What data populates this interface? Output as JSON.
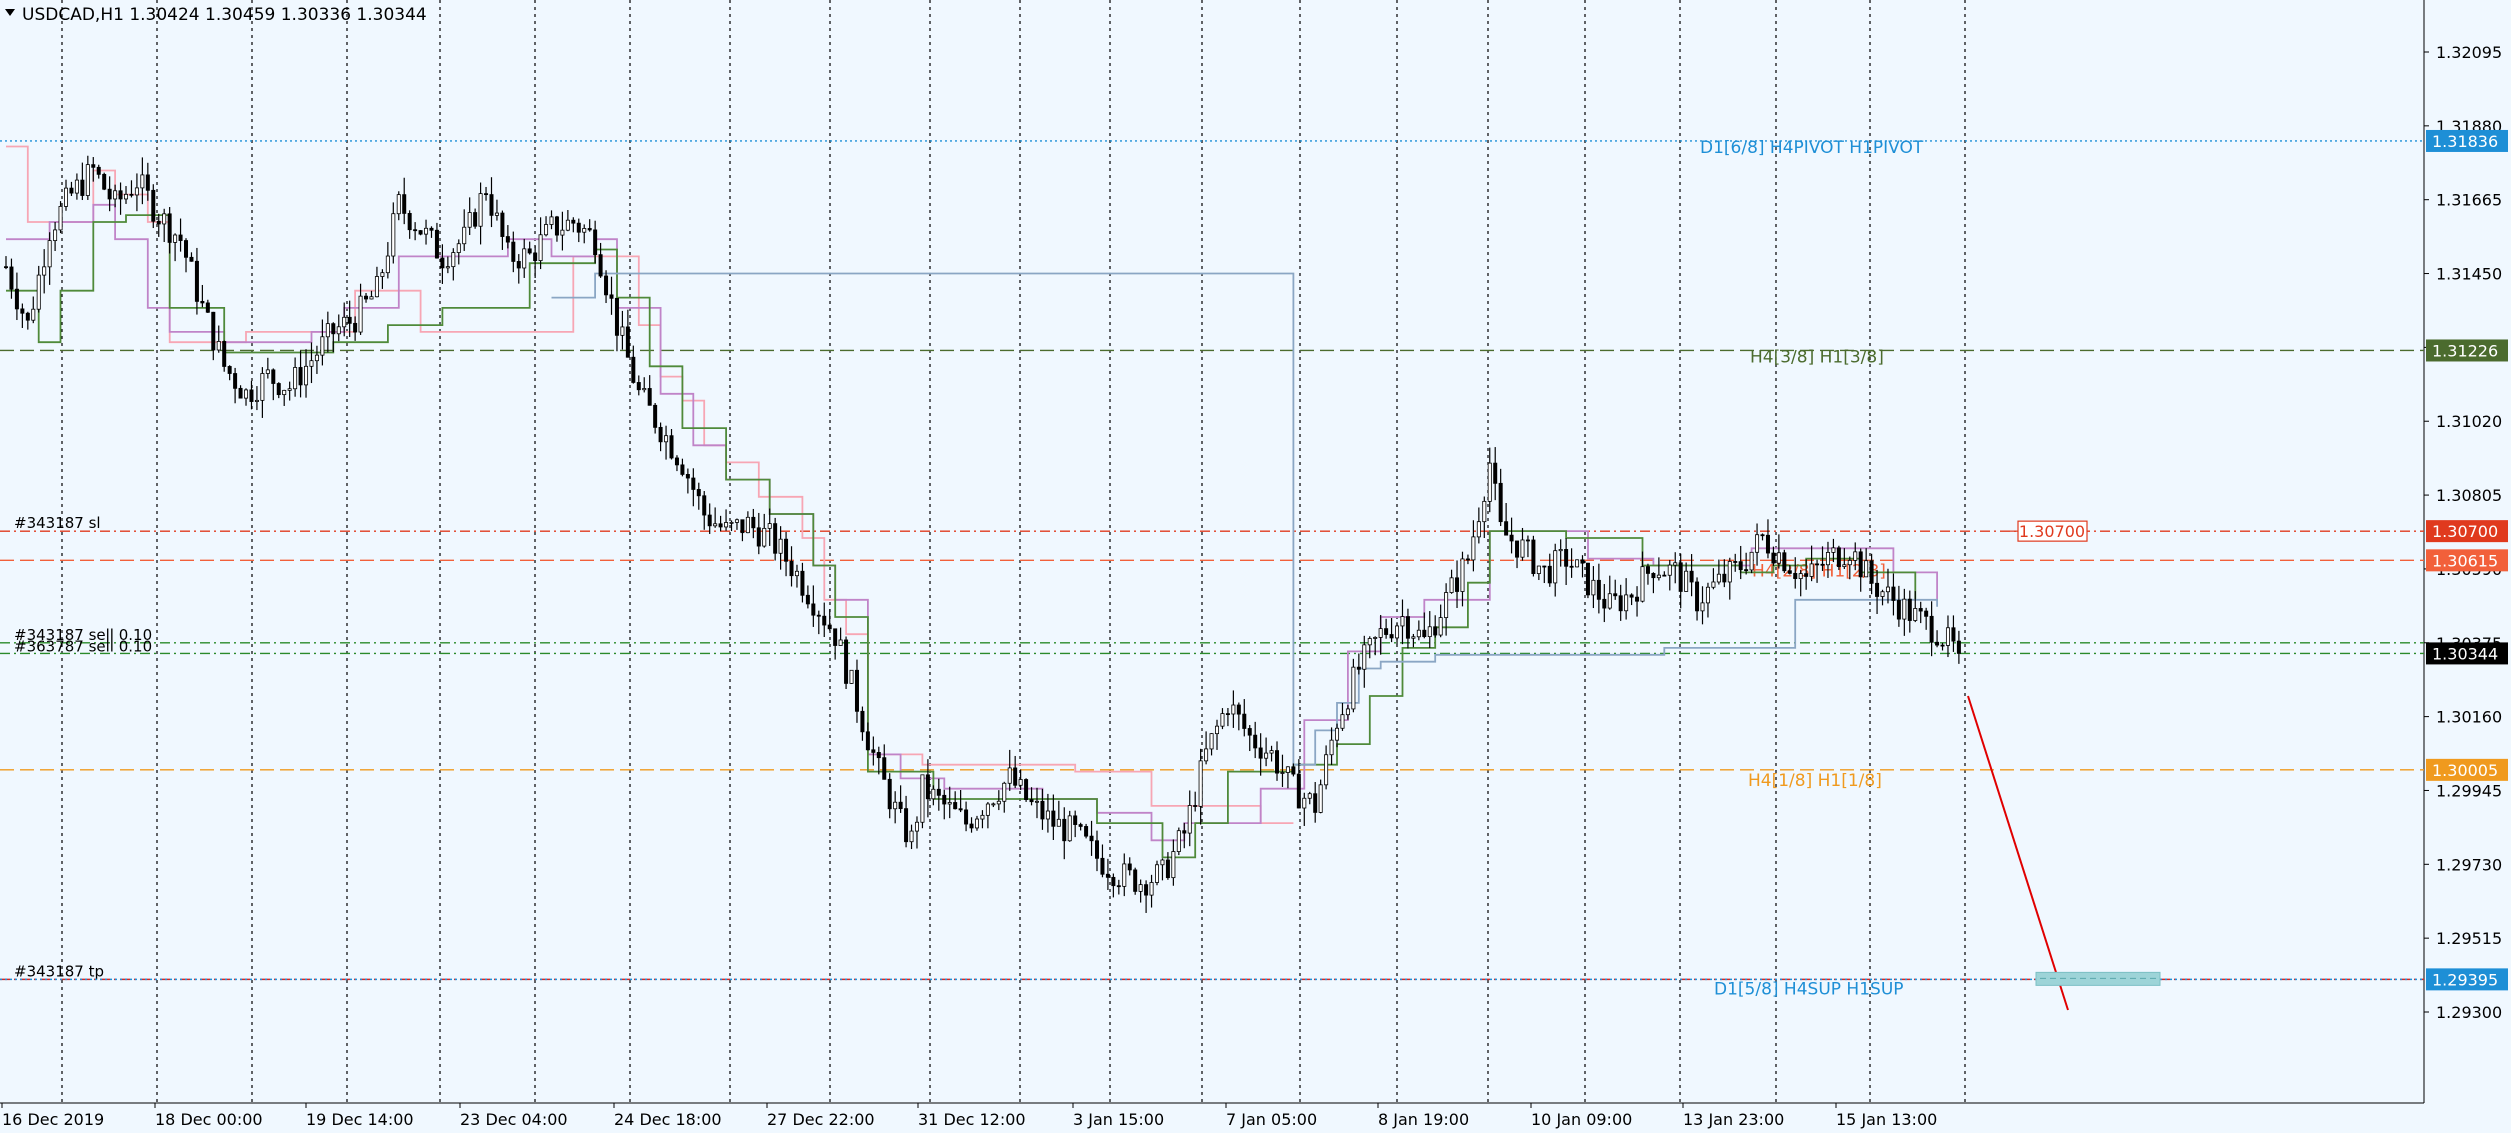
{
  "window": {
    "symbol_title": "USDCAD,H1  1.30424 1.30459 1.30336 1.30344"
  },
  "colors": {
    "background": "#f0f8ff",
    "grid": "#000000",
    "candle_up": "#3a3a3a",
    "candle_down": "#111111",
    "line_pink": "#f7a6b4",
    "line_violet": "#c084c8",
    "line_green": "#4f8a3a",
    "line_blue": "#8aa6c4",
    "trend_arrow": "#e00000",
    "target_box": "#9dd4d8"
  },
  "chart_data": {
    "type": "candlestick",
    "symbol": "USDCAD",
    "timeframe": "H1",
    "ohlc_header": {
      "open": 1.30424,
      "high": 1.30459,
      "low": 1.30336,
      "close": 1.30344
    },
    "ylim": [
      1.292,
      1.322
    ],
    "y_ticks": [
      "1.32095",
      "1.31880",
      "1.31665",
      "1.31450",
      "1.31235",
      "1.31020",
      "1.30805",
      "1.30590",
      "1.30375",
      "1.30160",
      "1.29945",
      "1.29730",
      "1.29515",
      "1.29300"
    ],
    "x_ticks": [
      "16 Dec 2019",
      "18 Dec 00:00",
      "19 Dec 14:00",
      "23 Dec 04:00",
      "24 Dec 18:00",
      "27 Dec 22:00",
      "31 Dec 12:00",
      "3 Jan 15:00",
      "7 Jan 05:00",
      "8 Jan 19:00",
      "10 Jan 09:00",
      "13 Jan 23:00",
      "15 Jan 13:00"
    ],
    "grid": true,
    "bars": 218,
    "price_path": [
      [
        0,
        1.3147
      ],
      [
        4,
        1.313
      ],
      [
        8,
        1.3158
      ],
      [
        12,
        1.3168
      ],
      [
        16,
        1.3175
      ],
      [
        20,
        1.3165
      ],
      [
        24,
        1.3172
      ],
      [
        28,
        1.3162
      ],
      [
        32,
        1.3155
      ],
      [
        36,
        1.3135
      ],
      [
        40,
        1.3118
      ],
      [
        44,
        1.311
      ],
      [
        48,
        1.3115
      ],
      [
        52,
        1.3112
      ],
      [
        56,
        1.312
      ],
      [
        60,
        1.3128
      ],
      [
        64,
        1.3132
      ],
      [
        68,
        1.314
      ],
      [
        72,
        1.3165
      ],
      [
        76,
        1.3158
      ],
      [
        80,
        1.315
      ],
      [
        84,
        1.3155
      ],
      [
        88,
        1.317
      ],
      [
        92,
        1.315
      ],
      [
        96,
        1.315
      ],
      [
        100,
        1.3158
      ],
      [
        104,
        1.316
      ],
      [
        108,
        1.3155
      ],
      [
        112,
        1.313
      ],
      [
        116,
        1.311
      ],
      [
        120,
        1.31
      ],
      [
        124,
        1.309
      ],
      [
        128,
        1.3075
      ],
      [
        132,
        1.307
      ],
      [
        136,
        1.3072
      ],
      [
        140,
        1.3068
      ],
      [
        144,
        1.306
      ],
      [
        148,
        1.305
      ],
      [
        152,
        1.304
      ],
      [
        156,
        1.302
      ],
      [
        160,
        1.3
      ],
      [
        164,
        1.2985
      ],
      [
        166,
        1.298
      ],
      [
        168,
        1.2995
      ],
      [
        172,
        1.299
      ],
      [
        176,
        1.2985
      ],
      [
        180,
        1.2992
      ],
      [
        184,
        1.2998
      ],
      [
        188,
        1.299
      ],
      [
        192,
        1.2985
      ],
      [
        196,
        1.2982
      ],
      [
        200,
        1.2975
      ],
      [
        204,
        1.297
      ],
      [
        208,
        1.2968
      ],
      [
        212,
        1.297
      ],
      [
        216,
        1.2982
      ],
      [
        220,
        1.3005
      ],
      [
        224,
        1.302
      ],
      [
        228,
        1.301
      ],
      [
        232,
        1.3005
      ],
      [
        236,
        1.2995
      ],
      [
        240,
        1.299
      ],
      [
        244,
        1.3015
      ],
      [
        248,
        1.303
      ],
      [
        252,
        1.304
      ],
      [
        256,
        1.3045
      ],
      [
        260,
        1.3038
      ],
      [
        264,
        1.305
      ],
      [
        268,
        1.3062
      ],
      [
        272,
        1.309
      ],
      [
        274,
        1.307
      ],
      [
        278,
        1.3065
      ],
      [
        282,
        1.3058
      ],
      [
        286,
        1.3062
      ],
      [
        290,
        1.3055
      ],
      [
        294,
        1.3048
      ],
      [
        298,
        1.3052
      ],
      [
        302,
        1.306
      ],
      [
        306,
        1.3058
      ],
      [
        310,
        1.305
      ],
      [
        314,
        1.3055
      ],
      [
        318,
        1.306
      ],
      [
        322,
        1.3068
      ],
      [
        326,
        1.3062
      ],
      [
        330,
        1.3056
      ],
      [
        334,
        1.3062
      ],
      [
        338,
        1.3065
      ],
      [
        342,
        1.3055
      ],
      [
        346,
        1.305
      ],
      [
        350,
        1.3045
      ],
      [
        354,
        1.3041
      ],
      [
        358,
        1.3034
      ]
    ],
    "ma_lines": [
      {
        "color_key": "line_pink",
        "points": [
          [
            0,
            1.3182
          ],
          [
            4,
            1.316
          ],
          [
            10,
            1.316
          ],
          [
            16,
            1.3175
          ],
          [
            20,
            1.3168
          ],
          [
            26,
            1.316
          ],
          [
            30,
            1.3125
          ],
          [
            40,
            1.3125
          ],
          [
            44,
            1.3128
          ],
          [
            60,
            1.3128
          ],
          [
            64,
            1.314
          ],
          [
            72,
            1.314
          ],
          [
            76,
            1.3128
          ],
          [
            100,
            1.3128
          ],
          [
            104,
            1.315
          ],
          [
            112,
            1.315
          ],
          [
            116,
            1.313
          ],
          [
            120,
            1.3115
          ],
          [
            124,
            1.3108
          ],
          [
            128,
            1.3095
          ],
          [
            132,
            1.309
          ],
          [
            138,
            1.308
          ],
          [
            146,
            1.3068
          ],
          [
            150,
            1.305
          ],
          [
            154,
            1.304
          ],
          [
            158,
            1.3005
          ],
          [
            166,
            1.3005
          ],
          [
            168,
            1.3002
          ],
          [
            190,
            1.3002
          ],
          [
            196,
            1.3
          ],
          [
            210,
            1.299
          ],
          [
            216,
            1.299
          ],
          [
            230,
            1.2985
          ],
          [
            236,
            1.2985
          ]
        ]
      },
      {
        "color_key": "line_violet",
        "points": [
          [
            0,
            1.3155
          ],
          [
            8,
            1.316
          ],
          [
            16,
            1.3165
          ],
          [
            20,
            1.3155
          ],
          [
            26,
            1.3135
          ],
          [
            30,
            1.3128
          ],
          [
            40,
            1.3125
          ],
          [
            56,
            1.3128
          ],
          [
            62,
            1.3135
          ],
          [
            72,
            1.315
          ],
          [
            80,
            1.315
          ],
          [
            92,
            1.3155
          ],
          [
            100,
            1.315
          ],
          [
            108,
            1.3155
          ],
          [
            112,
            1.3135
          ],
          [
            120,
            1.311
          ],
          [
            126,
            1.3095
          ],
          [
            132,
            1.3085
          ],
          [
            140,
            1.3075
          ],
          [
            148,
            1.306
          ],
          [
            152,
            1.305
          ],
          [
            158,
            1.3005
          ],
          [
            164,
            1.2998
          ],
          [
            172,
            1.2995
          ],
          [
            190,
            1.2992
          ],
          [
            200,
            1.2988
          ],
          [
            210,
            1.298
          ],
          [
            216,
            1.2985
          ],
          [
            230,
            1.2995
          ],
          [
            238,
            1.3015
          ],
          [
            246,
            1.3035
          ],
          [
            252,
            1.3045
          ],
          [
            260,
            1.305
          ],
          [
            272,
            1.307
          ],
          [
            290,
            1.3062
          ],
          [
            302,
            1.306
          ],
          [
            320,
            1.3065
          ],
          [
            336,
            1.3065
          ],
          [
            346,
            1.3058
          ],
          [
            354,
            1.305
          ]
        ]
      },
      {
        "color_key": "line_green",
        "points": [
          [
            0,
            1.314
          ],
          [
            6,
            1.3125
          ],
          [
            10,
            1.314
          ],
          [
            16,
            1.316
          ],
          [
            22,
            1.3162
          ],
          [
            30,
            1.3135
          ],
          [
            40,
            1.3122
          ],
          [
            50,
            1.3122
          ],
          [
            60,
            1.3125
          ],
          [
            70,
            1.313
          ],
          [
            80,
            1.3135
          ],
          [
            96,
            1.3148
          ],
          [
            108,
            1.3152
          ],
          [
            112,
            1.3138
          ],
          [
            118,
            1.3118
          ],
          [
            124,
            1.31
          ],
          [
            132,
            1.3085
          ],
          [
            140,
            1.3075
          ],
          [
            148,
            1.306
          ],
          [
            152,
            1.3045
          ],
          [
            158,
            1.3
          ],
          [
            170,
            1.2992
          ],
          [
            200,
            1.2985
          ],
          [
            212,
            1.2975
          ],
          [
            218,
            1.2985
          ],
          [
            224,
            1.3
          ],
          [
            236,
            1.3002
          ],
          [
            244,
            1.3008
          ],
          [
            250,
            1.3022
          ],
          [
            256,
            1.3036
          ],
          [
            262,
            1.3042
          ],
          [
            268,
            1.3055
          ],
          [
            272,
            1.307
          ],
          [
            286,
            1.3068
          ],
          [
            300,
            1.306
          ],
          [
            318,
            1.3058
          ],
          [
            324,
            1.306
          ],
          [
            330,
            1.3062
          ],
          [
            340,
            1.3058
          ],
          [
            350,
            1.305
          ]
        ]
      },
      {
        "color_key": "line_blue",
        "points": [
          [
            100,
            1.3138
          ],
          [
            106,
            1.3138
          ],
          [
            108,
            1.3145
          ],
          [
            112,
            1.3145
          ],
          [
            236,
            1.3002
          ],
          [
            240,
            1.3012
          ],
          [
            244,
            1.302
          ],
          [
            248,
            1.303
          ],
          [
            252,
            1.3032
          ],
          [
            258,
            1.3032
          ],
          [
            262,
            1.3034
          ],
          [
            300,
            1.3034
          ],
          [
            304,
            1.3036
          ],
          [
            324,
            1.3036
          ],
          [
            328,
            1.305
          ],
          [
            350,
            1.305
          ],
          [
            354,
            1.3048
          ]
        ]
      }
    ],
    "horizontal_lines": [
      {
        "label": "D1[6/8] H4PIVOT H1PIVOT",
        "price": 1.31836,
        "tag": "1.31836",
        "color": "#1e8fd6",
        "style": "dotted"
      },
      {
        "label": "H4[3/8] H1[3/8]",
        "price": 1.31226,
        "tag": "1.31226",
        "color": "#4b6b2e",
        "style": "dashed"
      },
      {
        "label": "#343187 sl",
        "price": 1.307,
        "tag": "1.30700",
        "color": "#e03a1e",
        "style": "dashdot"
      },
      {
        "label": "H4[2/8] H1[2/8]",
        "price": 1.30615,
        "tag": "1.30615",
        "color": "#f2603a",
        "style": "dashed"
      },
      {
        "label": "#343187 sell 0.10",
        "price": 1.30375,
        "tag": "",
        "color": "#2a8a2a",
        "style": "dashdot"
      },
      {
        "label": "#363787 sell 0.10",
        "price": 1.30344,
        "tag": "1.30344",
        "color": "#2a8a2a",
        "style": "dashdot"
      },
      {
        "label": "H4[1/8] H1[1/8]",
        "price": 1.30005,
        "tag": "1.30005",
        "color": "#f09a1e",
        "style": "dashed"
      },
      {
        "label": "#343187 tp",
        "price": 1.29395,
        "tag": "",
        "color": "#d02a2a",
        "style": "dashdot"
      },
      {
        "label": "D1[5/8] H4SUP H1SUP",
        "price": 1.29395,
        "tag": "1.29395",
        "color": "#1e8fd6",
        "style": "dotted"
      }
    ],
    "annotations": {
      "sl_box_text": "1.30700",
      "arrow_from": [
        1.30345
      ],
      "arrow_to": [
        1.2941
      ]
    }
  }
}
